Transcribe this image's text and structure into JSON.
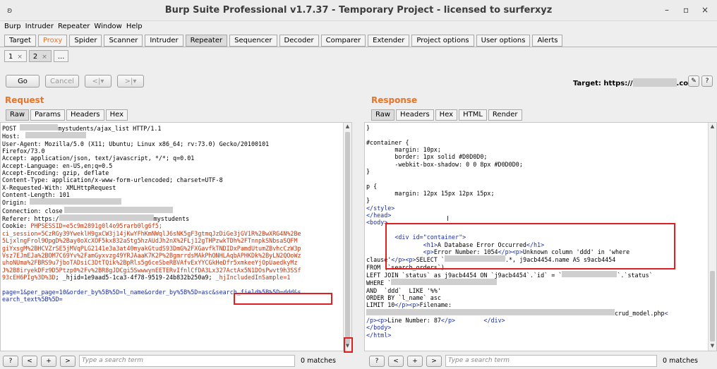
{
  "window": {
    "title": "Burp Suite Professional v1.7.37 - Temporary Project - licensed to surferxyz",
    "app_icon": "burp-icon",
    "controls": [
      "–",
      "▫",
      "×"
    ]
  },
  "menu": [
    "Burp",
    "Intruder",
    "Repeater",
    "Window",
    "Help"
  ],
  "tabs": [
    "Target",
    "Proxy",
    "Spider",
    "Scanner",
    "Intruder",
    "Repeater",
    "Sequencer",
    "Decoder",
    "Comparer",
    "Extender",
    "Project options",
    "User options",
    "Alerts"
  ],
  "selected_tab": "Repeater",
  "subtabs": [
    {
      "label": "1",
      "close": "×"
    },
    {
      "label": "2",
      "close": "×"
    },
    {
      "label": "..."
    }
  ],
  "toolbar": {
    "go": "Go",
    "cancel": "Cancel",
    "back": "<|▾",
    "forward": ">|▾",
    "target_label": "Target: https://",
    "target_suffix": ".com",
    "edit_icon": "pencil-icon",
    "help_icon": "?"
  },
  "request": {
    "title": "Request",
    "tabs": [
      "Raw",
      "Params",
      "Headers",
      "Hex"
    ],
    "lines": {
      "l1a": "POST ",
      "l1b": "mystudents/ajax_list HTTP/1.1",
      "l2": "Host:",
      "l3": "User-Agent: Mozilla/5.0 (X11; Ubuntu; Linux x86_64; rv:73.0) Gecko/20100101",
      "l4": "Firefox/73.0",
      "l5": "Accept: application/json, text/javascript, */*; q=0.01",
      "l6": "Accept-Language: en-US,en;q=0.5",
      "l7": "Accept-Encoding: gzip, deflate",
      "l8": "Content-Type: application/x-www-form-urlencoded; charset=UTF-8",
      "l9": "X-Requested-With: XMLHttpRequest",
      "l10": "Content-Length: 101",
      "l11": "Origin:",
      "l12": "Connection: close",
      "l13a": "Referer: https:/",
      "l13b": "mystudents",
      "l14a": "Cookie: ",
      "l14b": "PHPSESSID=e5c9m2891g0l4o95rarb0lg6f5;",
      "l15": "ci_session=5CzRGy39YweklH9gxCW3j14jKwYFhKmNWqlJ6sNK5gF3gtmqJzDiGe3jGV1R%2BwXRG4N%2Be",
      "l16": "5LjxlngFrol9OpgD%2Bay0oXcXOF5kx832aStg5hzAUdJh2nX%2FLj12gTHPzwkTDh%2FTnnpkSNbsaSQFM",
      "l17": "giYxsgM%2BHCVZrSE5jMVqPLG2141e3a3at40myakGtudS93DmG%2FXGavfkTNDIDxPamdUtumZBvhcCzW3p",
      "l18": "Vsz7EJmEJa%2BOM7C69Yv%2FamGyxvzg49YRJAaaK7K2P%2BgmrrdsMAkPhONHLAqbAPHKDk%2ByLN2QOoWz",
      "l19": "uhoNUma%2FBRS9u7jboTADsiC3DtTQik%2BpRls5g6ceSbeRBVAfvExYYCGkHeDfr5xmkeeYjOpUaedkyMz",
      "l20": "J%2B8iryekDFz9D5Ptzp0%2Fv%2BR8gJDCgi5SwwwynEETERvIfnlCfDA3Lx327ActAx5N1DOsPwvt9h3SSf",
      "l21a": "93cEH6PIg%3D%3D",
      "l21b": "; _hjid=1e9aad5-1ca3-4f78-9519-24b832b250a9; ",
      "l21c": "_hjIncludedInSample=1",
      "l22a": "page=1&per_page=10&order_by%5B%5D=l_name&order_by%5B%5D=asc&",
      "l22b": "search_field%5B%5D=ddd",
      "l22c": "&s",
      "l23": "earch_text%5B%5D="
    },
    "search": {
      "help": "?",
      "prev": "<",
      "add": "+",
      "next": ">",
      "placeholder": "Type a search term",
      "matches": "0 matches"
    }
  },
  "response": {
    "title": "Response",
    "tabs": [
      "Raw",
      "Headers",
      "Hex",
      "HTML",
      "Render"
    ],
    "lines": {
      "r1": "}",
      "r2": "#container {",
      "r3": "        margin: 10px;",
      "r4": "        border: 1px solid #D0D0D0;",
      "r5": "        -webkit-box-shadow: 0 0 8px #D0D0D0;",
      "r6": "}",
      "r7": "p {",
      "r8": "        margin: 12px 15px 12px 15px;",
      "r9": "}",
      "r10": "</style>",
      "r11": "</head>",
      "r12": "<body>",
      "r13": "        <div id=\"container\">",
      "r14a": "                <h1>",
      "r14b": "A Database Error Occurred",
      "r14c": "</h1>",
      "r15a": "                <p>",
      "r15b": "Error Number: 1054",
      "r15c": "</p><p>",
      "r15d": "Unknown column 'ddd' in 'where",
      "r16a": "clause'",
      "r16b": "</p><p>",
      "r16c": "SELECT `",
      "r16d": ".*, j9acb4454.name AS s9acb4454",
      "r17": "FROM (`search_orders`)",
      "r18a": "LEFT JOIN `status` as j9acb4454 ON `j9acb4454`.`id` = `",
      "r18b": "`.`status`",
      "r19": "WHERE `",
      "r20": "AND  `ddd`  LIKE '%%'",
      "r21": "ORDER BY `l_name` asc",
      "r22a": "LIMIT 10",
      "r22b": "</p><p>",
      "r22c": "Filename:",
      "r23": "crud_model.php",
      "r23b": "<",
      "r24a": "/p><p>",
      "r24b": "Line Number: 87",
      "r24c": "</p>",
      "r24d": "</div>",
      "r25": "</body>",
      "r26": "</html>"
    },
    "search": {
      "help": "?",
      "prev": "<",
      "add": "+",
      "next": ">",
      "placeholder": "Type a search term",
      "matches": "0 matches"
    }
  },
  "colors": {
    "accent": "#e8742a",
    "highlight_box": "#e02020",
    "param_red": "#c9330a",
    "tag_blue": "#1a2ea8"
  }
}
